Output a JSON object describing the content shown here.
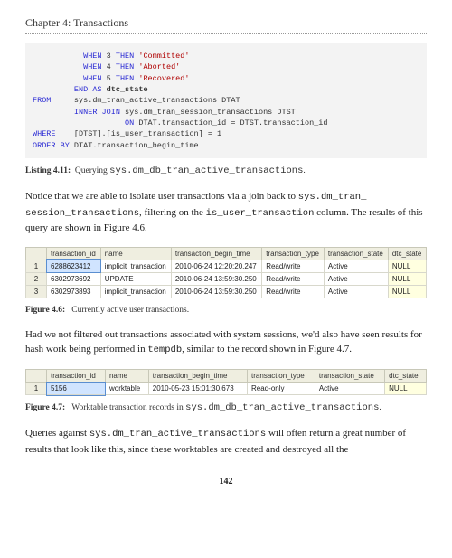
{
  "chapter": {
    "title": "Chapter 4: Transactions"
  },
  "code": {
    "l1a": "WHEN",
    "l1b": "3",
    "l1c": "THEN",
    "l1d": "'Committed'",
    "l2a": "WHEN",
    "l2b": "4",
    "l2c": "THEN",
    "l2d": "'Aborted'",
    "l3a": "WHEN",
    "l3b": "5",
    "l3c": "THEN",
    "l3d": "'Recovered'",
    "l4a": "END AS",
    "l4b": "dtc_state",
    "l5a": "FROM",
    "l5b": "sys.dm_tran_active_transactions DTAT",
    "l6a": "INNER JOIN",
    "l6b": "sys.dm_tran_session_transactions DTST",
    "l7a": "ON",
    "l7b": "DTAT.transaction_id = DTST.transaction_id",
    "l8a": "WHERE",
    "l8b": "[DTST].[is_user_transaction] = 1",
    "l9a": "ORDER BY",
    "l9b": "DTAT.transaction_begin_time"
  },
  "listing411": {
    "label": "Listing 4.11:",
    "text_a": "Querying ",
    "code": "sys.dm_db_tran_active_transactions",
    "text_b": "."
  },
  "para1": {
    "a": "Notice that we are able to isolate user transactions via a join back to ",
    "code1": "sys.dm_tran_",
    "code1b": "session_transactions",
    "b": ", filtering on the ",
    "code2": "is_user_transaction",
    "c": " column. The results of this query are shown in Figure 4.6."
  },
  "table46": {
    "headers": [
      "",
      "transaction_id",
      "name",
      "transaction_begin_time",
      "transaction_type",
      "transaction_state",
      "dtc_state"
    ],
    "rows": [
      [
        "1",
        "6288623412",
        "implicit_transaction",
        "2010-06-24 12:20:20.247",
        "Read/write",
        "Active",
        "NULL"
      ],
      [
        "2",
        "6302973692",
        "UPDATE",
        "2010-06-24 13:59:30.250",
        "Read/write",
        "Active",
        "NULL"
      ],
      [
        "3",
        "6302973893",
        "implicit_transaction",
        "2010-06-24 13:59:30.250",
        "Read/write",
        "Active",
        "NULL"
      ]
    ]
  },
  "figure46": {
    "label": "Figure 4.6:",
    "text": "Currently active user transactions."
  },
  "para2": {
    "a": "Had we not filtered out transactions associated with system sessions, we'd also have seen results for hash work being performed in ",
    "code1": "tempdb",
    "b": ", similar to the record shown in Figure 4.7."
  },
  "table47": {
    "headers": [
      "",
      "transaction_id",
      "name",
      "transaction_begin_time",
      "transaction_type",
      "transaction_state",
      "dtc_state"
    ],
    "rows": [
      [
        "1",
        "5156",
        "worktable",
        "2010-05-23 15:01:30.673",
        "Read-only",
        "Active",
        "NULL"
      ]
    ]
  },
  "figure47": {
    "label": "Figure 4.7:",
    "text_a": "Worktable transaction records in ",
    "code": "sys.dm_db_tran_active_transactions",
    "text_b": "."
  },
  "para3": {
    "a": "Queries against ",
    "code1": "sys.dm_tran_active_transactions",
    "b": " will often return a great number of results that look like this, since these worktables are created and destroyed all the"
  },
  "page_number": "142"
}
